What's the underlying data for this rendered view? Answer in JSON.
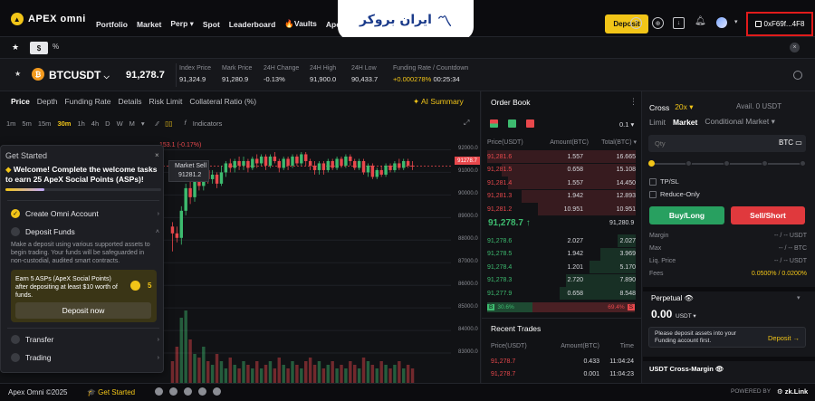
{
  "nav": {
    "brand": "APEX omni",
    "links": [
      "Portfolio",
      "Market",
      "Perp ▾",
      "Spot",
      "Leaderboard",
      "🔥Vaults",
      "Ape"
    ],
    "watermark": "ایران بروکر",
    "deposit_label": "Deposit",
    "wallet": "0xF69f...4F8"
  },
  "subbar": {
    "usd_tab": "$",
    "pct_tab": "%",
    "close": "×"
  },
  "ticker": {
    "symbol": "BTCUSDT",
    "last_price": "91,278.7",
    "stats": [
      {
        "label": "Index Price",
        "value": "91,324.9"
      },
      {
        "label": "Mark Price",
        "value": "91,280.9"
      },
      {
        "label": "24H Change",
        "value": "-0.13%"
      },
      {
        "label": "24H High",
        "value": "91,900.0"
      },
      {
        "label": "24H Low",
        "value": "90,433.7"
      },
      {
        "label": "Funding Rate / Countdown",
        "value": "+0.000278%",
        "value2": "00:25:34"
      }
    ]
  },
  "chart": {
    "tabs": [
      "Price",
      "Depth",
      "Funding Rate",
      "Details",
      "Risk Limit",
      "Collateral Ratio (%)"
    ],
    "ai_summary": "✦ AI Summary",
    "intervals": [
      "1m",
      "5m",
      "15m",
      "30m",
      "1h",
      "4h",
      "D",
      "W",
      "M",
      "▾"
    ],
    "active_interval": "30m",
    "indicators": "Indicators",
    "price_labels": [
      "92000.0",
      "91000.0",
      "90000.0",
      "89000.0",
      "88000.0",
      "87000.0",
      "86000.0",
      "85000.0",
      "84000.0",
      "83000.0"
    ],
    "current_price_tag": "91278.7",
    "ma_label": "153.1 (-0.17%)",
    "market_sell": "Market Sell",
    "market_sell_price": "91281.2"
  },
  "get_started": {
    "title": "Get Started",
    "close": "×",
    "welcome": "Welcome! Complete the welcome tasks to earn 25 ApeX Social Points (ASPs)!",
    "progress": 0.25,
    "items": [
      {
        "label": "Create Omni Account",
        "done": true,
        "chev": "›"
      },
      {
        "label": "Deposit Funds",
        "done": false,
        "chev": "˄"
      },
      {
        "label": "Transfer",
        "done": false,
        "chev": "›"
      },
      {
        "label": "Trading",
        "done": false,
        "chev": "›"
      }
    ],
    "deposit_desc": "Make a deposit using various supported assets to begin trading. Your funds will be safeguarded in non-custodial, audited smart contracts.",
    "earn_text": "Earn 5 ASPs (ApeX Social Points) after depositing at least $10 worth of funds.",
    "earn_value": "5",
    "deposit_now": "Deposit now"
  },
  "order_book": {
    "title": "Order Book",
    "tick": "0.1 ▾",
    "headers": [
      "Price(USDT)",
      "Amount(BTC)",
      "Total(BTC) ▾"
    ],
    "asks": [
      {
        "price": "91,281.6",
        "amount": "1.557",
        "total": "16.665",
        "depth": 1.0
      },
      {
        "price": "91,281.5",
        "amount": "0.658",
        "total": "15.108",
        "depth": 0.9
      },
      {
        "price": "91,281.4",
        "amount": "1.557",
        "total": "14.450",
        "depth": 0.86
      },
      {
        "price": "91,281.3",
        "amount": "1.942",
        "total": "12.893",
        "depth": 0.77
      },
      {
        "price": "91,281.2",
        "amount": "10.951",
        "total": "10.951",
        "depth": 0.66
      }
    ],
    "mid_price": "91,278.7 ↑",
    "mid_ref": "91,280.9",
    "bids": [
      {
        "price": "91,278.6",
        "amount": "2.027",
        "total": "2.027",
        "depth": 0.12
      },
      {
        "price": "91,278.5",
        "amount": "1.942",
        "total": "3.969",
        "depth": 0.24
      },
      {
        "price": "91,278.4",
        "amount": "1.201",
        "total": "5.170",
        "depth": 0.31
      },
      {
        "price": "91,278.3",
        "amount": "2.720",
        "total": "7.890",
        "depth": 0.47
      },
      {
        "price": "91,277.9",
        "amount": "0.658",
        "total": "8.548",
        "depth": 0.51
      }
    ],
    "buy_ratio_label": "B",
    "buy_ratio": "30.6%",
    "sell_ratio": "69.4%",
    "sell_ratio_label": "S",
    "buy_ratio_value": 0.306
  },
  "recent_trades": {
    "title": "Recent Trades",
    "headers": [
      "Price(USDT)",
      "Amount(BTC)",
      "Time"
    ],
    "rows": [
      {
        "price": "91,278.7",
        "amount": "0.433",
        "time": "11:04:24"
      },
      {
        "price": "91,278.7",
        "amount": "0.001",
        "time": "11:04:23"
      }
    ]
  },
  "trade_panel": {
    "margin_mode": "Cross",
    "leverage": "20x ▾",
    "avail": "Avail. 0 USDT",
    "order_tabs": [
      "Limit",
      "Market",
      "Conditional Market ▾"
    ],
    "active_tab": "Market",
    "qty_placeholder": "Qty",
    "qty_unit": "BTC ▭",
    "tpsl": "TP/SL",
    "reduce_only": "Reduce-Only",
    "buy_label": "Buy/Long",
    "sell_label": "Sell/Short",
    "info": [
      {
        "k": "Margin",
        "v": "-- / -- USDT"
      },
      {
        "k": "Max",
        "v": "-- / -- BTC"
      },
      {
        "k": "Liq. Price",
        "v": "-- / -- USDT"
      },
      {
        "k": "Fees",
        "v": "0.0500% / 0.0200%"
      }
    ],
    "perpetual": "Perpetual 👁",
    "perp_chev": "▾",
    "perp_balance": "0.00",
    "perp_unit": "USDT ▾",
    "deposit_note": "Please deposit assets into your Funding account first.",
    "deposit_link": "Deposit →",
    "usdt_margin": "USDT Cross-Margin 👁"
  },
  "footer": {
    "copyright": "Apex Omni ©2025",
    "get_started": "🎓 Get Started",
    "powered_by": "POWERED BY",
    "zklink": "⚙ zk.Link"
  },
  "colors": {
    "accent": "#f2c518",
    "up": "#3dbb6f",
    "down": "#e8484c",
    "wallet_highlight": "#e11b1b"
  },
  "icons": [
    "help-icon",
    "globe-icon",
    "download-icon",
    "bell-icon",
    "avatar-icon",
    "wallet-icon",
    "star-icon",
    "fire-icon",
    "btc-icon",
    "settings-icon",
    "expand-icon",
    "coin-icon"
  ],
  "chart_data": {
    "type": "candlestick",
    "ylim": [
      82000,
      92500
    ],
    "candles": [
      [
        88600,
        88300,
        88800,
        87500
      ],
      [
        88300,
        88100,
        88600,
        87900
      ],
      [
        88100,
        89300,
        89500,
        87800
      ],
      [
        89300,
        90300,
        90500,
        89100
      ],
      [
        90300,
        89900,
        90600,
        89600
      ],
      [
        89900,
        90700,
        90900,
        89700
      ],
      [
        90700,
        90400,
        90900,
        90200
      ],
      [
        90400,
        91100,
        91200,
        90200
      ],
      [
        91100,
        90700,
        91300,
        90500
      ],
      [
        90700,
        90900,
        91100,
        90500
      ],
      [
        90900,
        90500,
        91000,
        90300
      ],
      [
        90500,
        91000,
        91300,
        90400
      ],
      [
        91000,
        91400,
        91500,
        90800
      ],
      [
        91400,
        91200,
        91600,
        91000
      ],
      [
        91200,
        91500,
        91600,
        91000
      ],
      [
        91500,
        91300,
        91700,
        91100
      ],
      [
        91300,
        91500,
        91700,
        91100
      ],
      [
        91500,
        91200,
        91600,
        91000
      ],
      [
        91200,
        91600,
        91700,
        91100
      ],
      [
        91600,
        91400,
        91800,
        91200
      ],
      [
        91400,
        91700,
        91800,
        91300
      ],
      [
        91700,
        91300,
        91800,
        91100
      ],
      [
        91300,
        91700,
        91800,
        91200
      ],
      [
        91700,
        91500,
        91900,
        91400
      ],
      [
        91500,
        91200,
        91600,
        91000
      ],
      [
        91200,
        91600,
        91700,
        91100
      ],
      [
        91600,
        91300,
        91700,
        91100
      ],
      [
        91300,
        91700,
        91800,
        91200
      ],
      [
        91700,
        91400,
        91800,
        91300
      ],
      [
        91400,
        91800,
        91900,
        91300
      ],
      [
        91800,
        91500,
        91900,
        91300
      ],
      [
        91500,
        91300,
        91600,
        91100
      ],
      [
        91300,
        91100,
        91500,
        90900
      ],
      [
        91100,
        91400,
        91500,
        90900
      ],
      [
        91400,
        91100,
        91500,
        90900
      ],
      [
        91100,
        91500,
        91600,
        91000
      ],
      [
        91500,
        91200,
        91600,
        91100
      ],
      [
        91200,
        91600,
        91700,
        91100
      ],
      [
        91600,
        91300,
        91700,
        91200
      ],
      [
        91300,
        91700,
        91800,
        91200
      ],
      [
        91700,
        91500,
        91800,
        91300
      ],
      [
        91500,
        91200,
        91600,
        91100
      ],
      [
        91200,
        91500,
        91600,
        91100
      ],
      [
        91500,
        91000,
        91600,
        90900
      ],
      [
        91000,
        91300,
        91400,
        90800
      ],
      [
        91300,
        90800,
        91400,
        90700
      ],
      [
        90800,
        91100,
        91200,
        90700
      ],
      [
        91100,
        90900,
        91300,
        90800
      ],
      [
        90900,
        91300,
        91400,
        90800
      ],
      [
        91300,
        91100,
        91400,
        91000
      ],
      [
        91100,
        91400,
        91500,
        91000
      ],
      [
        91400,
        91200,
        91600,
        91100
      ],
      [
        91200,
        91500,
        91600,
        91100
      ],
      [
        91500,
        91300,
        91600,
        91200
      ],
      [
        91300,
        91278,
        91500,
        91100
      ]
    ],
    "volumes": [
      0.3,
      0.5,
      0.9,
      1.0,
      0.6,
      0.4,
      0.35,
      0.5,
      0.3,
      0.25,
      0.4,
      0.3,
      0.2,
      0.35,
      0.25,
      0.2,
      0.3,
      0.25,
      0.2,
      0.3,
      0.2,
      0.25,
      0.3,
      0.2,
      0.35,
      0.25,
      0.2,
      0.3,
      0.25,
      0.2,
      0.3,
      0.35,
      0.25,
      0.3,
      0.2,
      0.25,
      0.3,
      0.2,
      0.25,
      0.2,
      0.3,
      0.25,
      0.2,
      0.35,
      0.3,
      0.25,
      0.2,
      0.3,
      0.25,
      0.2,
      0.25,
      0.3,
      0.2,
      0.25,
      0.2
    ]
  }
}
